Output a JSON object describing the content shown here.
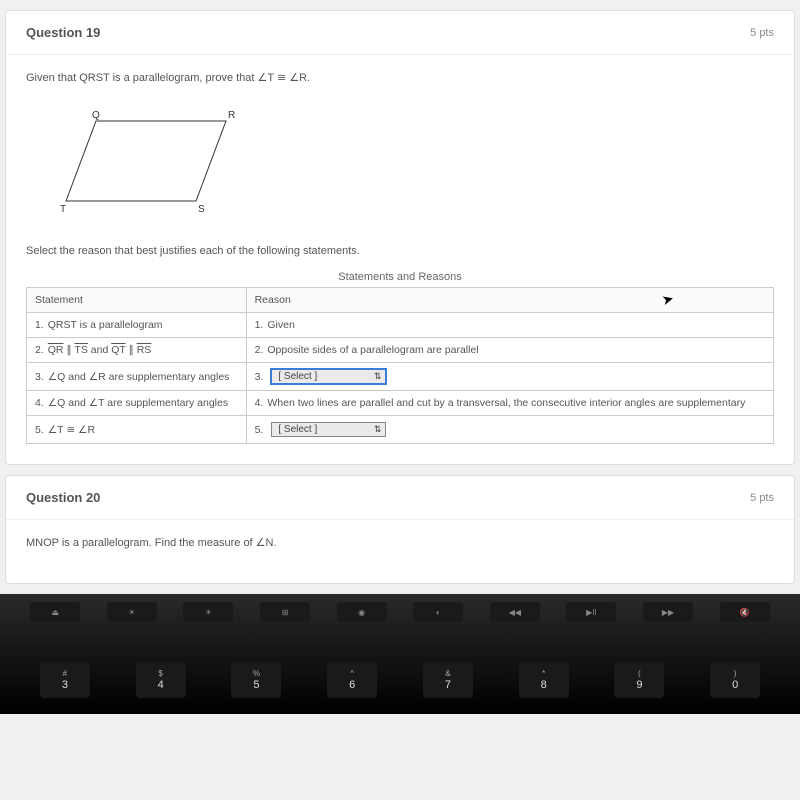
{
  "q19": {
    "title": "Question 19",
    "points": "5 pts",
    "prompt_prefix": "Given that QRST is a parallelogram, prove that ",
    "prompt_math": "∠T ≅ ∠R.",
    "labels": {
      "Q": "Q",
      "R": "R",
      "S": "S",
      "T": "T"
    },
    "instruction": "Select the reason that best justifies each of the following statements.",
    "caption": "Statements and Reasons",
    "headers": {
      "statement": "Statement",
      "reason": "Reason"
    },
    "rows": [
      {
        "n": "1.",
        "stmt": "QRST is a parallelogram",
        "rn": "1.",
        "reason_text": "Given"
      },
      {
        "n": "2.",
        "stmt_html": "QR ∥ TS and QT ∥ RS",
        "rn": "2.",
        "reason_text": "Opposite sides of a parallelogram are parallel"
      },
      {
        "n": "3.",
        "stmt": "∠Q and ∠R are supplementary angles",
        "rn": "3.",
        "select_placeholder": "[ Select ]"
      },
      {
        "n": "4.",
        "stmt": "∠Q and ∠T are supplementary angles",
        "rn": "4.",
        "reason_text": "When two lines are parallel and cut by a transversal, the consecutive interior angles are supplementary"
      },
      {
        "n": "5.",
        "stmt": "∠T ≅ ∠R",
        "rn": "5.",
        "select_placeholder": "[ Select ]"
      }
    ]
  },
  "q20": {
    "title": "Question 20",
    "points": "5 pts",
    "prompt": "MNOP is a parallelogram. Find the measure of ∠N."
  },
  "keyboard": {
    "fn": [
      "⏏",
      "☀",
      "☀",
      "⊞",
      "◉",
      "◐",
      "◀◀",
      "▶II",
      "▶▶",
      "🔇"
    ],
    "row": [
      {
        "t": "#",
        "b": "3"
      },
      {
        "t": "$",
        "b": "4"
      },
      {
        "t": "%",
        "b": "5"
      },
      {
        "t": "^",
        "b": "6"
      },
      {
        "t": "&",
        "b": "7"
      },
      {
        "t": "*",
        "b": "8"
      },
      {
        "t": "(",
        "b": "9"
      },
      {
        "t": ")",
        "b": "0"
      }
    ]
  }
}
